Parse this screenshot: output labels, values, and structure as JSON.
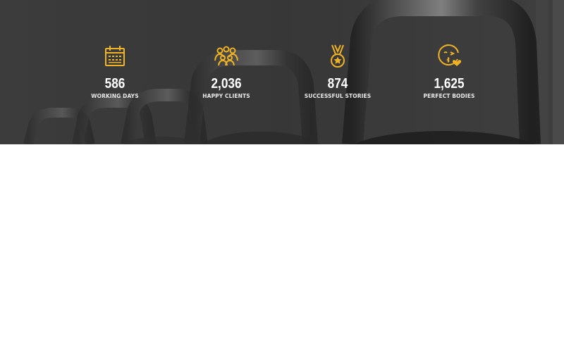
{
  "theme": {
    "accent": "#f0b323",
    "overlay": "#3c3c3c",
    "text": "#ffffff"
  },
  "stats": [
    {
      "icon": "calendar-icon",
      "number": "586",
      "label": "WORKING DAYS"
    },
    {
      "icon": "group-icon",
      "number": "2,036",
      "label": "HAPPY CLIENTS"
    },
    {
      "icon": "medal-icon",
      "number": "874",
      "label": "SUCCESSFUL STORIES"
    },
    {
      "icon": "wink-heart-face-icon",
      "number": "1,625",
      "label": "PERFECT BODIES"
    }
  ]
}
